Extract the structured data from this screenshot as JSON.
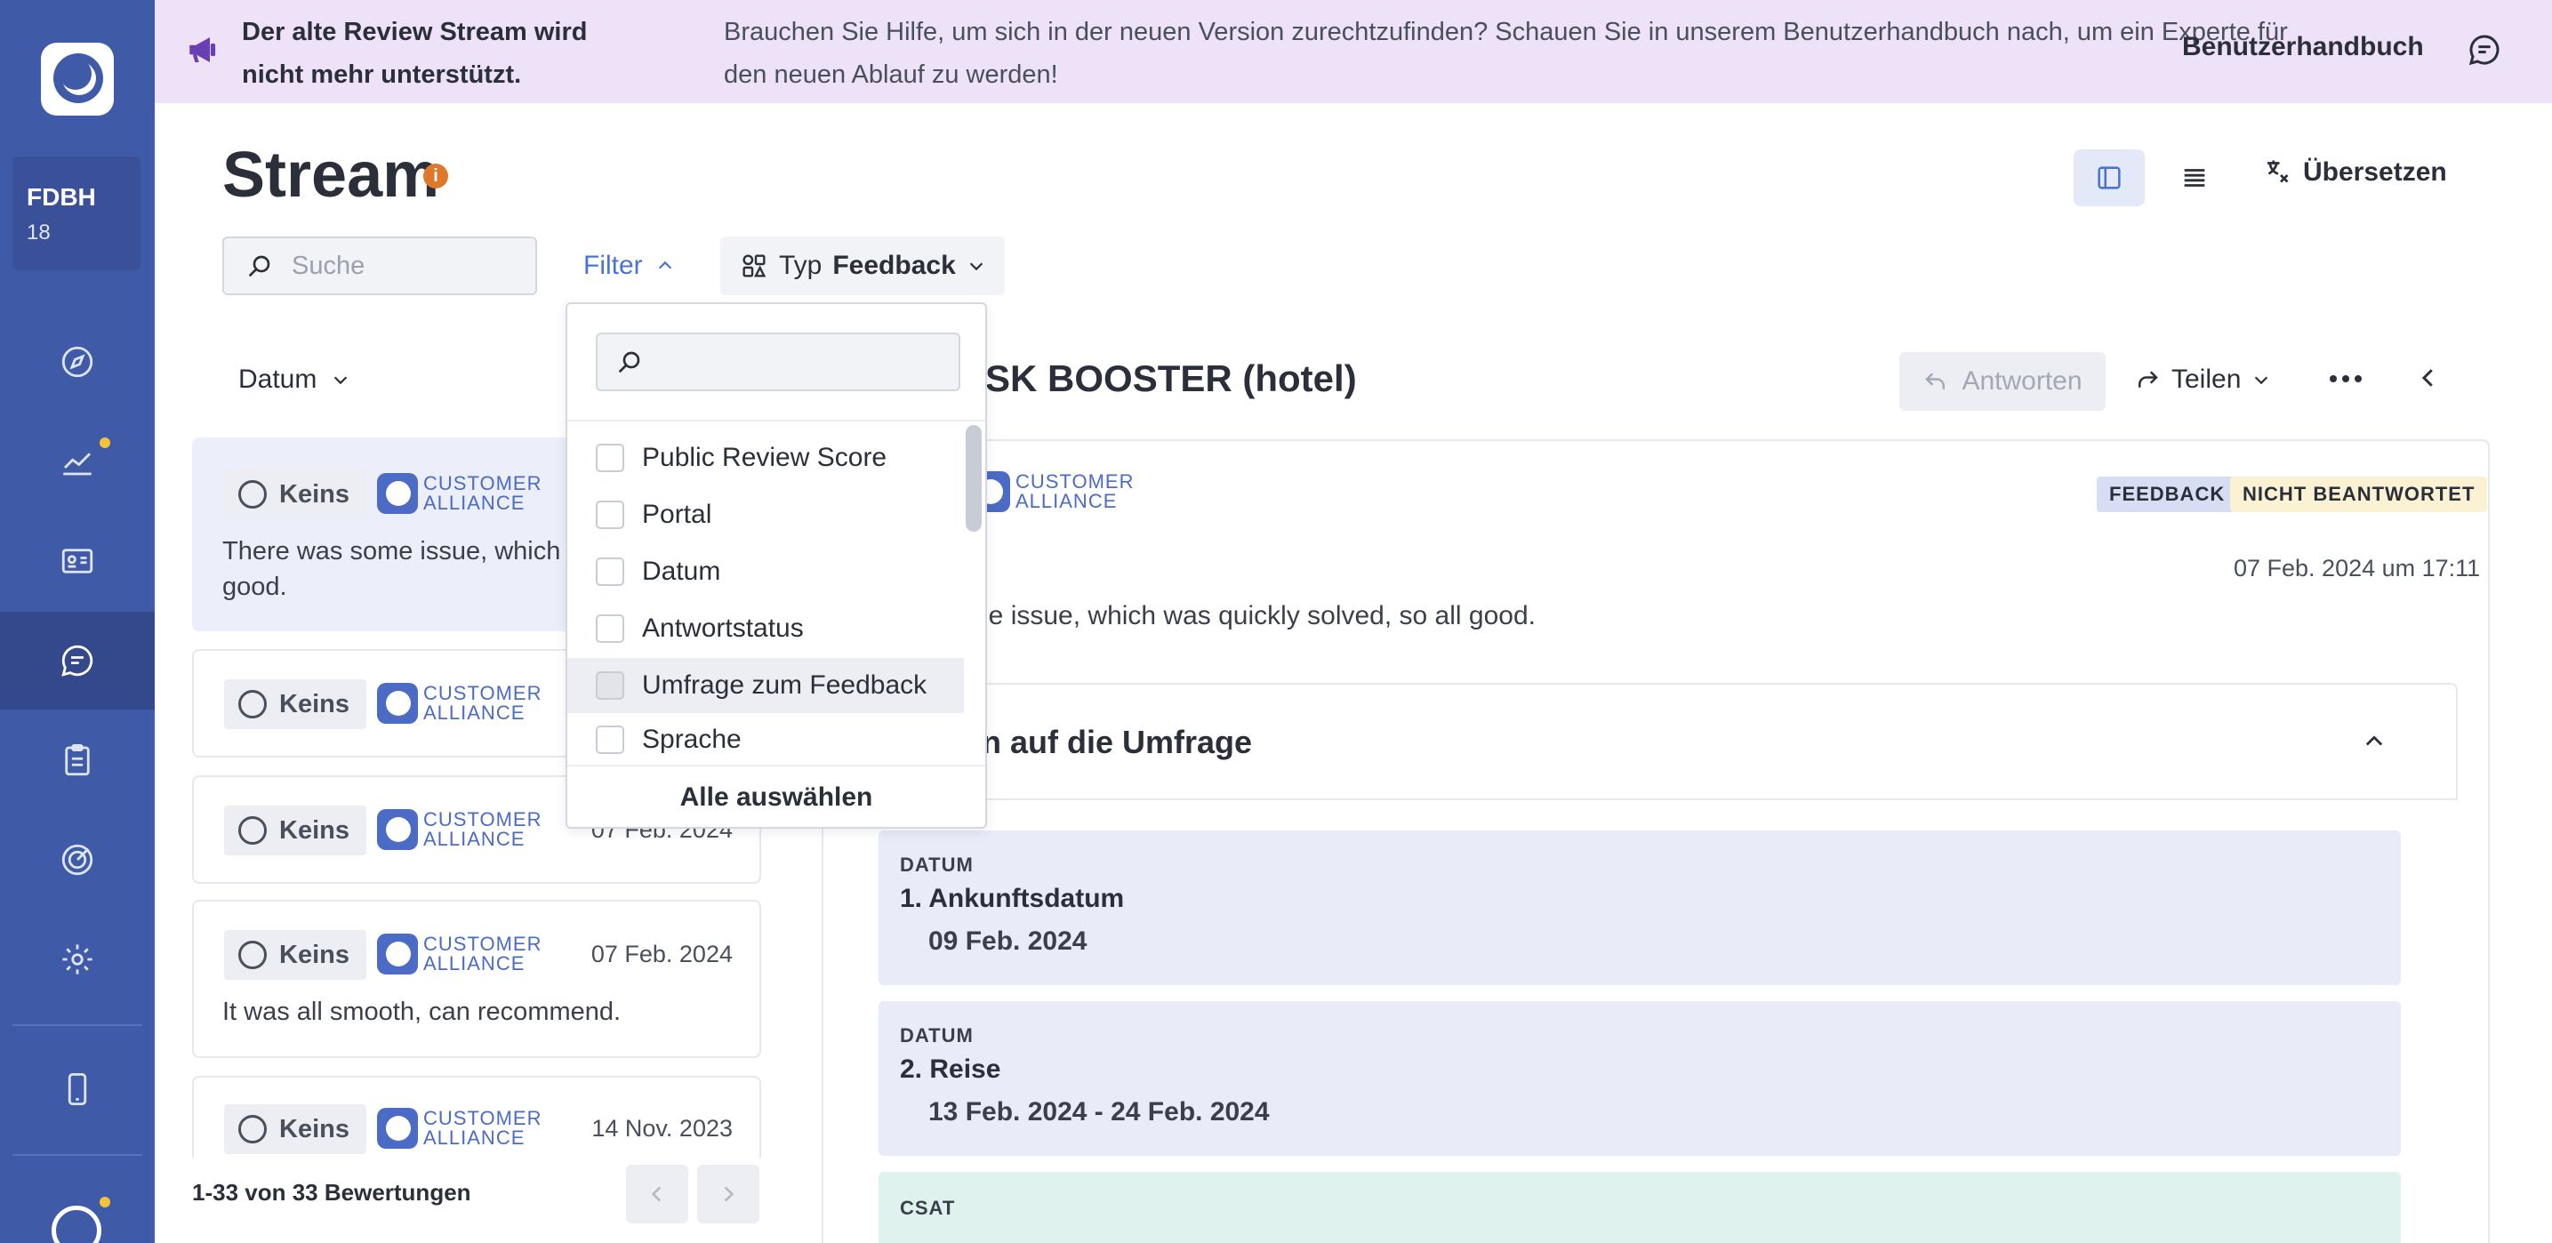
{
  "sidebar": {
    "account_name": "FDBH",
    "account_count": "18"
  },
  "banner": {
    "title": "Der alte Review Stream wird nicht mehr unterstützt.",
    "text": "Brauchen Sie Hilfe, um sich in der neuen Version zurechtzufinden? Schauen Sie in unserem Benutzerhandbuch nach, um ein Experte für den neuen Ablauf zu werden!",
    "link": "Benutzerhandbuch"
  },
  "header": {
    "title": "Stream",
    "info": "i",
    "translate_label": "Übersetzen"
  },
  "toolbar": {
    "search_placeholder": "Suche",
    "filter_label": "Filter",
    "typ_label": "Typ",
    "typ_value": "Feedback"
  },
  "filter_dropdown": {
    "search_value": "",
    "options": [
      "Public Review Score",
      "Portal",
      "Datum",
      "Antwortstatus",
      "Umfrage zum Feedback",
      "Sprache"
    ],
    "select_all": "Alle auswählen"
  },
  "list": {
    "sort_label": "Datum",
    "items": [
      {
        "status": "Keins",
        "brand_line1": "CUSTOMER",
        "brand_line2": "ALLIANCE",
        "date": "",
        "text": "There was some issue, which solved, so all good."
      },
      {
        "status": "Keins",
        "brand_line1": "CUSTOMER",
        "brand_line2": "ALLIANCE",
        "date": "",
        "text": ""
      },
      {
        "status": "Keins",
        "brand_line1": "CUSTOMER",
        "brand_line2": "ALLIANCE",
        "date": "07 Feb. 2024",
        "text": ""
      },
      {
        "status": "Keins",
        "brand_line1": "CUSTOMER",
        "brand_line2": "ALLIANCE",
        "date": "07 Feb. 2024",
        "text": "It was all smooth, can recommend."
      },
      {
        "status": "Keins",
        "brand_line1": "CUSTOMER",
        "brand_line2": "ALLIANCE",
        "date": "14 Nov. 2023",
        "text": ""
      }
    ],
    "pagination_text": "1-33 von 33 Bewertungen"
  },
  "detail": {
    "title": "ESK BOOSTER (hotel)",
    "reply_label": "Antworten",
    "share_label": "Teilen",
    "brand_line1": "CUSTOMER",
    "brand_line2": "ALLIANCE",
    "badge_type": "FEEDBACK",
    "badge_status": "NICHT BEANTWORTET",
    "date": "07 Feb. 2024 um 17:11",
    "text": "ome issue, which was quickly solved, so all good.",
    "survey_title": "en auf die Umfrage",
    "questions": [
      {
        "kind": "DATUM",
        "title": "1. Ankunftsdatum",
        "answer": "09 Feb. 2024"
      },
      {
        "kind": "DATUM",
        "title": "2. Reise",
        "answer": "13 Feb. 2024 - 24 Feb. 2024"
      },
      {
        "kind": "CSAT",
        "title": "",
        "answer": ""
      }
    ]
  },
  "colors": {
    "sidebar": "#3f5ba8",
    "banner": "#ede2f8",
    "accent": "#4b73d6",
    "warning": "#e0782c"
  }
}
